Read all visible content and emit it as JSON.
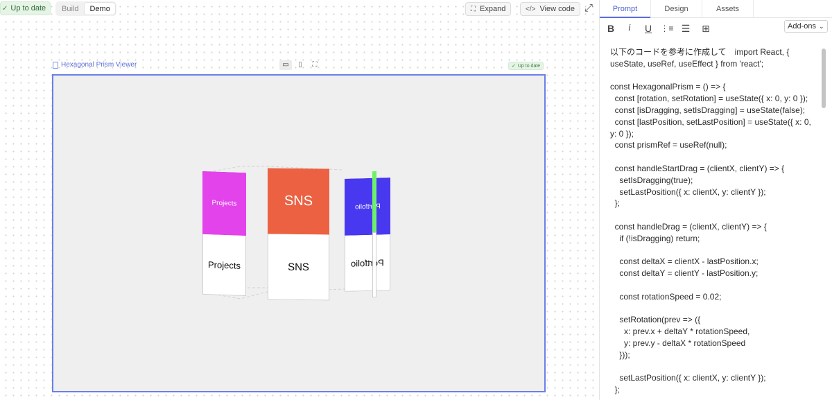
{
  "topbar": {
    "status": "Up to date",
    "segments": [
      {
        "label": "Build",
        "active": false
      },
      {
        "label": "Demo",
        "active": true
      }
    ],
    "expand_label": "Expand",
    "view_code_label": "View code"
  },
  "preview": {
    "title": "Hexagonal Prism Viewer",
    "status_badge": "Up to date",
    "devices": [
      "desktop-icon",
      "mobile-icon",
      "fullscreen-icon"
    ]
  },
  "prism": {
    "faces": [
      {
        "label": "Projects",
        "color": "#e243ea"
      },
      {
        "label": "SNS",
        "color": "#eb6142"
      },
      {
        "label": "Portfolio",
        "color": "#4838f0"
      }
    ],
    "edge_color": "#6ef06b"
  },
  "panel": {
    "tabs": [
      {
        "label": "Prompt",
        "active": true
      },
      {
        "label": "Design",
        "active": false
      },
      {
        "label": "Assets",
        "active": false
      }
    ],
    "format_icons": [
      "bold-icon",
      "italic-icon",
      "underline-icon",
      "ordered-list-icon",
      "bullet-list-icon",
      "add-image-icon"
    ],
    "addons_label": "Add-ons",
    "prompt": "以下のコードを参考に作成して　import React, { useState, useRef, useEffect } from 'react';\n\nconst HexagonalPrism = () => {\n  const [rotation, setRotation] = useState({ x: 0, y: 0 });\n  const [isDragging, setIsDragging] = useState(false);\n  const [lastPosition, setLastPosition] = useState({ x: 0, y: 0 });\n  const prismRef = useRef(null);\n\n  const handleStartDrag = (clientX, clientY) => {\n    setIsDragging(true);\n    setLastPosition({ x: clientX, y: clientY });\n  };\n\n  const handleDrag = (clientX, clientY) => {\n    if (!isDragging) return;\n\n    const deltaX = clientX - lastPosition.x;\n    const deltaY = clientY - lastPosition.y;\n\n    const rotationSpeed = 0.02;\n\n    setRotation(prev => ({\n      x: prev.x + deltaY * rotationSpeed,\n      y: prev.y - deltaX * rotationSpeed\n    }));\n\n    setLastPosition({ x: clientX, y: clientY });\n  };"
  }
}
